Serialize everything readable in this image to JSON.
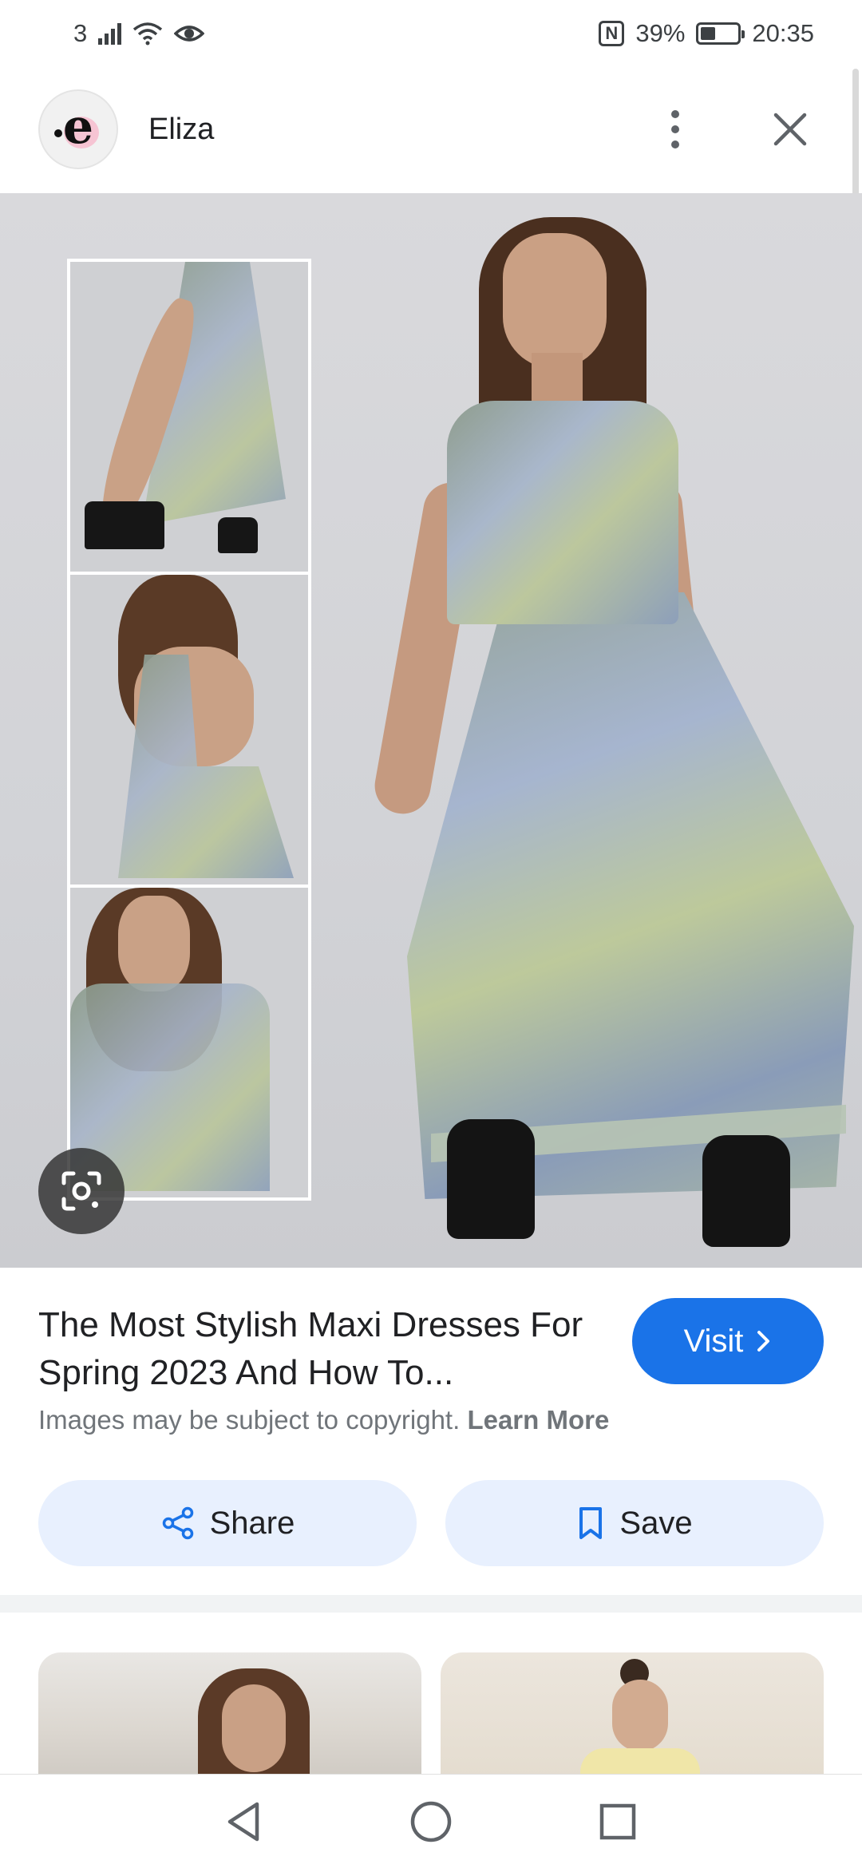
{
  "status_bar": {
    "sim_label": "3",
    "battery_percent": "39%",
    "battery_level": 0.39,
    "time": "20:35",
    "nfc_label": "N"
  },
  "header": {
    "source_name": "Eliza",
    "avatar_letter": "e",
    "more_icon": "more-vert-icon",
    "close_icon": "close-icon"
  },
  "viewer": {
    "lens_icon": "google-lens-icon"
  },
  "result": {
    "title": "The Most Stylish Maxi Dresses For Spring 2023 And How To...",
    "visit_label": "Visit",
    "copyright_text": "Images may be subject to copyright.",
    "learn_more_label": "Learn More",
    "share_label": "Share",
    "save_label": "Save"
  },
  "colors": {
    "accent": "#1a73e8",
    "button_bg": "#e8f0fe",
    "secondary_text": "#70757a"
  },
  "nav": {
    "back_icon": "back-triangle-icon",
    "home_icon": "home-circle-icon",
    "recents_icon": "recents-square-icon"
  }
}
